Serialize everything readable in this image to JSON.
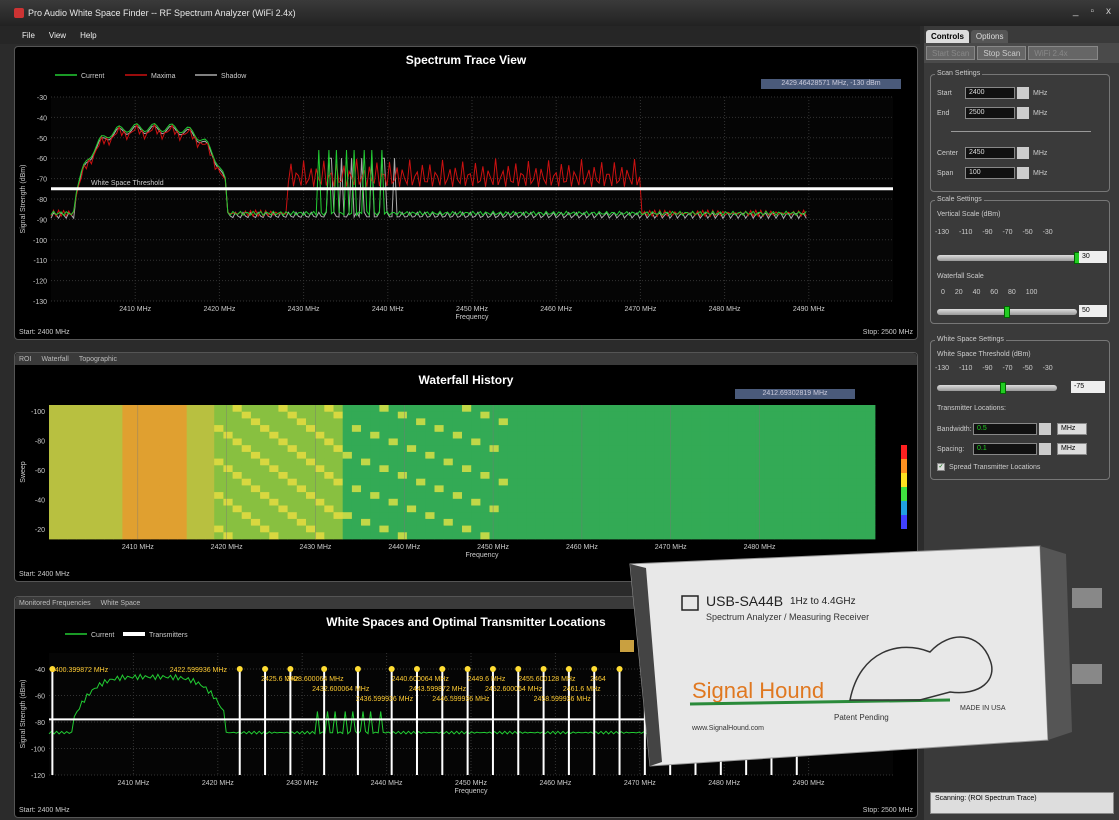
{
  "window": {
    "title": "Pro Audio White Space Finder -- RF Spectrum Analyzer (WiFi 2.4x)",
    "controls": [
      "_",
      "▫",
      "x"
    ]
  },
  "menu": [
    "File",
    "View",
    "Help"
  ],
  "trace": {
    "title": "Spectrum Trace View",
    "legend": [
      "Current",
      "Maxima",
      "Shadow"
    ],
    "readout": "2429.46428571 MHz, -130 dBm",
    "ylabel": "Signal Strength (dBm)",
    "xlabel": "Frequency",
    "yticks": [
      "-30",
      "-40",
      "-50",
      "-60",
      "-70",
      "-80",
      "-90",
      "-100",
      "-110",
      "-120",
      "-130"
    ],
    "xticks": [
      "2410 MHz",
      "2420 MHz",
      "2430 MHz",
      "2440 MHz",
      "2450 MHz",
      "2460 MHz",
      "2470 MHz",
      "2480 MHz",
      "2490 MHz"
    ],
    "threshold_label": "White Space Threshold",
    "start": "Start: 2400 MHz",
    "stop": "Stop: 2500 MHz"
  },
  "waterfall": {
    "tabs": [
      "ROI",
      "Waterfall",
      "Topographic"
    ],
    "title": "Waterfall History",
    "readout": "2412.69302819 MHz",
    "ylabel": "Sweep",
    "yticks": [
      "-100",
      "-80",
      "-60",
      "-40",
      "-20"
    ],
    "xticks": [
      "2410 MHz",
      "2420 MHz",
      "2430 MHz",
      "2440 MHz",
      "2450 MHz",
      "2460 MHz",
      "2470 MHz",
      "2480 MHz"
    ],
    "xlabel": "Frequency",
    "start": "Start: 2400 MHz"
  },
  "whitespace": {
    "tabs": [
      "Monitored Frequencies",
      "White Space"
    ],
    "title": "White Spaces and Optimal Transmitter Locations",
    "legend": [
      "Current",
      "Transmitters"
    ],
    "ylabel": "Signal Strength (dBm)",
    "yticks": [
      "-40",
      "-60",
      "-80",
      "-100",
      "-120"
    ],
    "xticks": [
      "2410 MHz",
      "2420 MHz",
      "2430 MHz",
      "2440 MHz",
      "2450 MHz",
      "2460 MHz",
      "2470 MHz",
      "2480 MHz",
      "2490 MHz"
    ],
    "xlabel": "Frequency",
    "labels": [
      "2400.399872 MHz",
      "2422.599936 MHz",
      "2425.6 MHz",
      "2428.600064 MHz",
      "2432.600064 MHz",
      "2436.599936 MHz",
      "2440.600064 MHz",
      "2443.599872 MHz",
      "2446.599936 MHz",
      "2449.6 MHz",
      "2452.600064 MHz",
      "2455.600128 MHz",
      "2458.599936 MHz",
      "2461.6 MHz",
      "2464"
    ],
    "start": "Start: 2400 MHz",
    "stop": "Stop: 2500 MHz"
  },
  "controls": {
    "tabs": [
      "Controls",
      "Options"
    ],
    "buttons": [
      "Start Scan",
      "Stop Scan",
      "WiFi 2.4x"
    ],
    "scan": {
      "title": "Scan Settings",
      "start_label": "Start",
      "start": "2400",
      "end_label": "End",
      "end": "2500",
      "center_label": "Center",
      "center": "2450",
      "span_label": "Span",
      "span": "100",
      "unit": "MHz"
    },
    "scale": {
      "title": "Scale Settings",
      "vlabel": "Vertical Scale (dBm)",
      "vticks": "-130 -110 -90 -70 -50 -30",
      "vvalue": "30",
      "vlevel": 1.0,
      "wlabel": "Waterfall Scale",
      "wticks": "0 20 40 60 80 100",
      "wvalue": "50",
      "wlevel": 0.5
    },
    "ws": {
      "title": "White Space Settings",
      "tlabel": "White Space Threshold (dBm)",
      "tticks": "-130 -110 -90 -70 -50 -30",
      "tvalue": "-75",
      "tlevel": 0.55,
      "loc_label": "Transmitter Locations:",
      "bw_label": "Bandwidth:",
      "bw": "0.5",
      "sp_label": "Spacing:",
      "sp": "0.1",
      "unit": "MHz",
      "spread": "Spread Transmitter Locations"
    },
    "status": "Scanning: (ROI Spectrum Trace)"
  },
  "device": {
    "model": "USB-SA44B",
    "range": "1Hz to 4.4GHz",
    "subtitle": "Spectrum Analyzer / Measuring Receiver",
    "brand": "Signal Hound",
    "web": "www.SignalHound.com",
    "patent": "Patent Pending",
    "made": "MADE IN USA"
  },
  "colors": {
    "current": "#22cc33",
    "maxima": "#cc1111",
    "shadow": "#aaaaaa",
    "accent": "#ffcc33"
  }
}
